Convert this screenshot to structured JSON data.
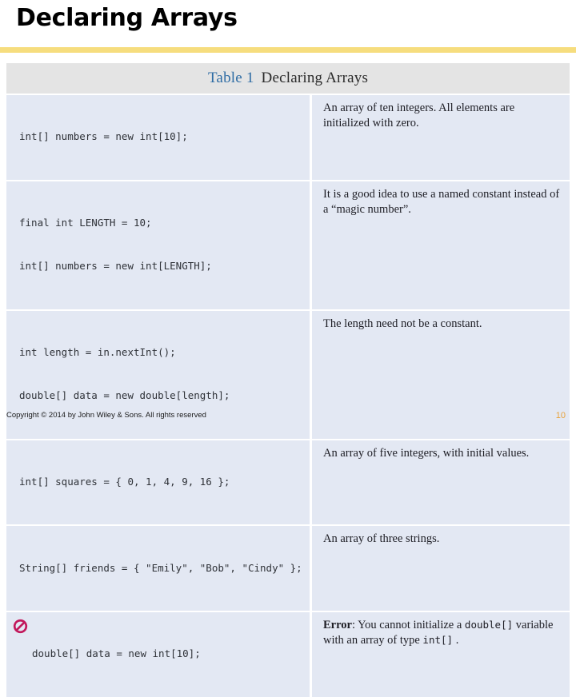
{
  "slide": {
    "title": "Declaring Arrays",
    "rule_color": "#f6dd7e"
  },
  "table": {
    "caption_number": "Table 1",
    "caption_title": "Declaring Arrays",
    "caption_number_color": "#2e6ca4",
    "row_background": "#e3e8f3",
    "caption_background": "#e4e4e4",
    "error_icon_color": "#c2185b",
    "rows": [
      {
        "code_line1": "int[] numbers = new int[10];",
        "code_line2": "",
        "description": "An array of ten integers. All elements are initialized with zero.",
        "has_error_icon": false
      },
      {
        "code_line1": "final int LENGTH = 10;",
        "code_line2": "int[] numbers = new int[LENGTH];",
        "description": "It is a good idea to use a named constant instead of a “magic number”.",
        "has_error_icon": false
      },
      {
        "code_line1": "int length = in.nextInt();",
        "code_line2": "double[] data = new double[length];",
        "description": "The length need not be a constant.",
        "has_error_icon": false
      },
      {
        "code_line1": "int[] squares = { 0, 1, 4, 9, 16 };",
        "code_line2": "",
        "description": "An array of five integers, with initial values.",
        "has_error_icon": false
      },
      {
        "code_line1": "String[] friends = { \"Emily\", \"Bob\", \"Cindy\" };",
        "code_line2": "",
        "description": "An array of three strings.",
        "has_error_icon": false
      },
      {
        "code_line1": "double[] data = new int[10];",
        "code_line2": "",
        "description_error_label": "Error",
        "description_part1": ": You cannot initialize a ",
        "description_code1": "double[]",
        "description_part2": " variable with an array of type ",
        "description_code2": "int[]",
        "description_part3": " .",
        "has_error_icon": true
      }
    ]
  },
  "footer": {
    "copyright": "Copyright © 2014 by John Wiley & Sons.  All rights reserved",
    "page_number": "10"
  }
}
